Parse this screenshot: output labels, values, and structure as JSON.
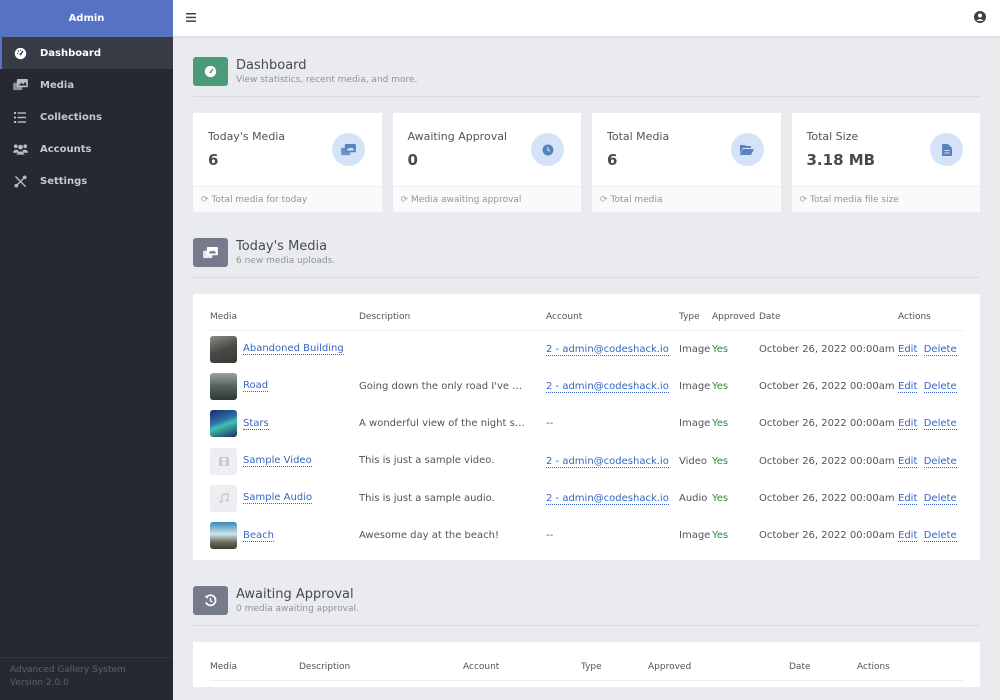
{
  "sidebar": {
    "brand": "Admin",
    "items": [
      {
        "label": "Dashboard",
        "icon": "dashboard-icon",
        "active": true
      },
      {
        "label": "Media",
        "icon": "media-icon"
      },
      {
        "label": "Collections",
        "icon": "list-icon"
      },
      {
        "label": "Accounts",
        "icon": "users-icon"
      },
      {
        "label": "Settings",
        "icon": "tools-icon"
      }
    ],
    "footer": {
      "app_name": "Advanced Gallery System",
      "version": "Version 2.0.0"
    }
  },
  "topbar": {
    "menu_icon": "hamburger-icon",
    "user_icon": "user-circle-icon"
  },
  "dashboard": {
    "title": "Dashboard",
    "subtitle": "View statistics, recent media, and more.",
    "accent": "#4a9a7b"
  },
  "stats": [
    {
      "label": "Today's Media",
      "value": "6",
      "footer": "Total media for today",
      "icon": "media-icon"
    },
    {
      "label": "Awaiting Approval",
      "value": "0",
      "footer": "Media awaiting approval",
      "icon": "clock-icon"
    },
    {
      "label": "Total Media",
      "value": "6",
      "footer": "Total media",
      "icon": "folder-open-icon"
    },
    {
      "label": "Total Size",
      "value": "3.18 MB",
      "footer": "Total media file size",
      "icon": "file-icon"
    }
  ],
  "todays_media": {
    "title": "Today's Media",
    "subtitle": "6 new media uploads.",
    "columns": [
      "Media",
      "Description",
      "Account",
      "Type",
      "Approved",
      "Date",
      "Actions"
    ],
    "rows": [
      {
        "title": "Abandoned Building",
        "description": "",
        "account": "2 - admin@codeshack.io",
        "type": "Image",
        "approved": "Yes",
        "date": "October 26, 2022 00:00am",
        "thumb": "building"
      },
      {
        "title": "Road",
        "description": "Going down the only road I've ev...",
        "account": "2 - admin@codeshack.io",
        "type": "Image",
        "approved": "Yes",
        "date": "October 26, 2022 00:00am",
        "thumb": "road"
      },
      {
        "title": "Stars",
        "description": "A wonderful view of the night sky.",
        "account": "--",
        "type": "Image",
        "approved": "Yes",
        "date": "October 26, 2022 00:00am",
        "thumb": "stars"
      },
      {
        "title": "Sample Video",
        "description": "This is just a sample video.",
        "account": "2 - admin@codeshack.io",
        "type": "Video",
        "approved": "Yes",
        "date": "October 26, 2022 00:00am",
        "thumb": "video"
      },
      {
        "title": "Sample Audio",
        "description": "This is just a sample audio.",
        "account": "2 - admin@codeshack.io",
        "type": "Audio",
        "approved": "Yes",
        "date": "October 26, 2022 00:00am",
        "thumb": "audio"
      },
      {
        "title": "Beach",
        "description": "Awesome day at the beach!",
        "account": "--",
        "type": "Image",
        "approved": "Yes",
        "date": "October 26, 2022 00:00am",
        "thumb": "beach"
      }
    ],
    "actions": {
      "edit": "Edit",
      "delete": "Delete"
    }
  },
  "awaiting": {
    "title": "Awaiting Approval",
    "subtitle": "0 media awaiting approval.",
    "columns": [
      "Media",
      "Description",
      "Account",
      "Type",
      "Approved",
      "Date",
      "Actions"
    ]
  }
}
